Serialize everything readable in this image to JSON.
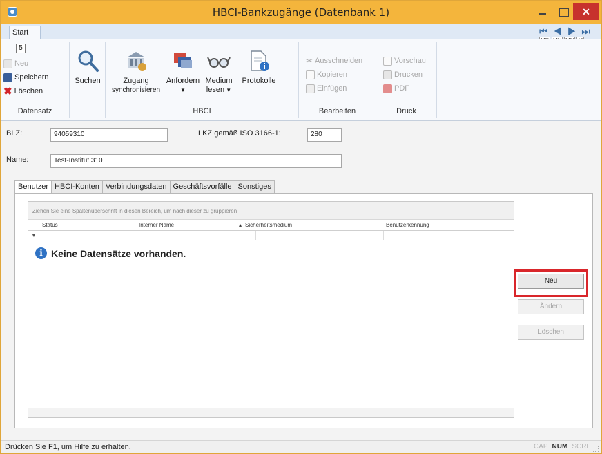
{
  "window": {
    "title": "HBCI-Bankzugänge (Datenbank 1)"
  },
  "ribbon": {
    "tab_start": "Start",
    "keytip": "5",
    "mini_keys": [
      "ME",
      "MV",
      "MN",
      "M"
    ],
    "datensatz": {
      "neu": "Neu",
      "speichern": "Speichern",
      "loeschen": "Löschen",
      "label": "Datensatz"
    },
    "suchen": "Suchen",
    "hbci": {
      "zugang_line1": "Zugang",
      "zugang_line2": "synchronisieren",
      "anfordern": "Anfordern",
      "medium_line1": "Medium",
      "medium_line2": "lesen",
      "protokolle": "Protokolle",
      "label": "HBCI"
    },
    "bearbeiten": {
      "ausschneiden": "Ausschneiden",
      "kopieren": "Kopieren",
      "einfuegen": "Einfügen",
      "label": "Bearbeiten"
    },
    "druck": {
      "vorschau": "Vorschau",
      "drucken": "Drucken",
      "pdf": "PDF",
      "label": "Druck"
    }
  },
  "form": {
    "blz_label": "BLZ:",
    "blz_value": "94059310",
    "lkz_label": "LKZ gemäß ISO 3166-1:",
    "lkz_value": "280",
    "name_label": "Name:",
    "name_value": "Test-Institut 310"
  },
  "tabs": [
    "Benutzer",
    "HBCI-Konten",
    "Verbindungsdaten",
    "Geschäftsvorfälle",
    "Sonstiges"
  ],
  "grid": {
    "group_hint": "Ziehen Sie eine Spaltenüberschrift in diesen Bereich, um nach dieser zu gruppieren",
    "columns": [
      "Status",
      "Interner Name",
      "Sicherheitsmedium",
      "Benutzerkennung"
    ],
    "empty_message": "Keine Datensätze vorhanden."
  },
  "side_buttons": {
    "neu": "Neu",
    "aendern": "Ändern",
    "loeschen": "Löschen"
  },
  "statusbar": {
    "text": "Drücken Sie F1, um Hilfe zu erhalten.",
    "cap": "CAP",
    "num": "NUM",
    "scrl": "SCRL"
  },
  "colors": {
    "titlebar": "#f4b53c",
    "close": "#c7322d",
    "highlight": "#d9262b",
    "ribbon": "#f7f9fc"
  }
}
